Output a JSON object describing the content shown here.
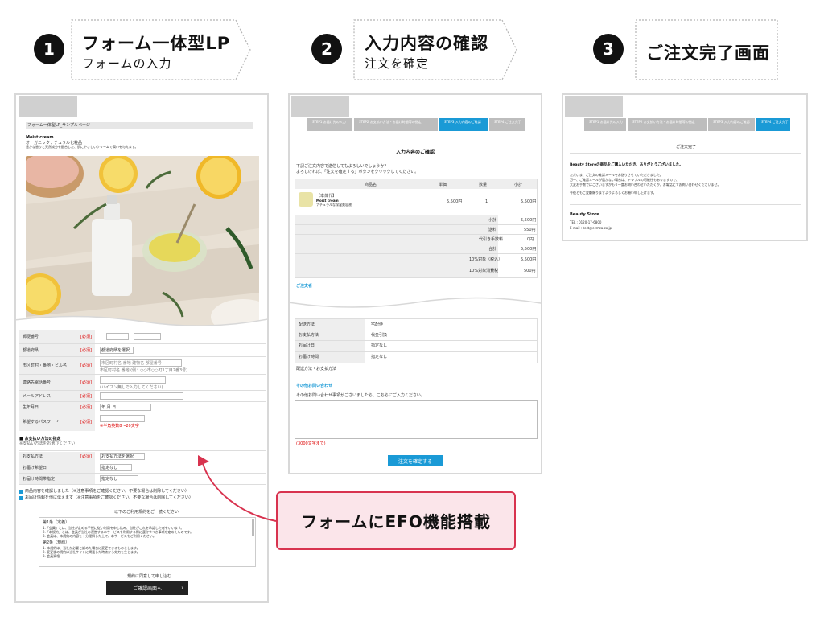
{
  "steps": [
    {
      "num": "1",
      "title": "フォーム一体型LP",
      "subtitle": "フォームの入力"
    },
    {
      "num": "2",
      "title": "入力内容の確認",
      "subtitle": "注文を確定"
    },
    {
      "num": "3",
      "title": "ご注文完了画面",
      "subtitle": ""
    }
  ],
  "callout": {
    "label": "フォームにEFO機能搭載"
  },
  "panel1": {
    "breadcrumb": "フォーム一体型LP_サンプルページ",
    "product_name": "Moist cream",
    "product_desc1": "オーガニックナチュラル化粧品",
    "product_desc2": "豊かな香りと天然成分を配合した、肌にやさしいクリームで潤いを与えます。",
    "fields": [
      {
        "label": "郵便番号",
        "req": "[必須]",
        "value": ""
      },
      {
        "label": "都道府県",
        "req": "[必須]",
        "value": "都道府県を選択"
      },
      {
        "label": "市区町村・番地・ビル名",
        "req": "[必須]",
        "value": "市区町村名 番地 建物名 部屋番号"
      },
      {
        "label": "連絡先電話番号",
        "req": "[必須]",
        "value": ""
      },
      {
        "label": "メールアドレス",
        "req": "[必須]",
        "value": ""
      },
      {
        "label": "生年月日",
        "req": "[必須]",
        "value": "年  月  日"
      },
      {
        "label": "希望するパスワード",
        "req": "[必須]",
        "value": ""
      }
    ],
    "address_note": "市区町村名 番地 (例：○○市○○町1丁目2番3号)",
    "phone_note": "(ハイフン無しで入力してください)",
    "password_note": "※半角英数8〜20文字",
    "payment_heading": "お支払い方法の指定",
    "payment_note": "※支払い方法をお選びください",
    "payment_rows": [
      {
        "label": "お支払方法",
        "req": "[必須]",
        "value": "お支払方法を選択"
      },
      {
        "label": "お届け希望日",
        "req": "",
        "value": "指定なし"
      },
      {
        "label": "お届け時間帯指定",
        "req": "",
        "value": "指定なし"
      }
    ],
    "check1": "商品内容を確認しました（※注意事項をご確認ください。不要な場合は削除してください）",
    "check2": "お届け情報を他に伝えます（※注意事項をご確認ください。不要な場合は削除してください）",
    "terms_heading": "以下のご利用規約をご一読ください",
    "terms_lines": [
      "第1条（定義）",
      "1.「会員」とは、当社が定める手続に従い利用を申し込み、当社がこれを承認した者をいいます。",
      "2.「本規約」とは、会員が当社の運営する本サービスを利用する際に遵守すべき事項を定めたものです。",
      "3. 会員は、本規約の内容を十分理解した上で、本サービスをご利用ください。",
      "第2条（規約）",
      "1. 本規約は、当社が必要と認めた場合に変更できるものとします。",
      "2. 変更後の規約は当社サイトに掲載した時点から効力を生じます。",
      "3. 会員資格"
    ],
    "agree_text": "規約に同意して申し込む",
    "confirm_button": "ご確認画面へ"
  },
  "panel2": {
    "progress": [
      "STEP1 お届け先の入力",
      "STEP2 お支払い方法・お届け時間等の指定",
      "STEP3 入力内容のご確認",
      "STEP4 ご注文完了"
    ],
    "heading": "入力内容のご確認",
    "intro1": "下記ご注文内容で送信してもよろしいでしょうか？",
    "intro2": "よろしければ、「注文を確定する」ボタンをクリックしてください。",
    "table_headers": [
      "商品名",
      "単価",
      "数量",
      "小計"
    ],
    "item_badge": "【本体代】",
    "item_name": "Moist cream",
    "item_desc": "ナチュラルな保湿美容液",
    "item_price": "5,500円",
    "item_qty": "1",
    "item_subtotal": "5,500円",
    "summary": [
      {
        "label": "小計",
        "value": "5,500円"
      },
      {
        "label": "送料",
        "value": "550円"
      },
      {
        "label": "代引き手数料",
        "value": "0円"
      },
      {
        "label": "合計",
        "value": "5,500円"
      }
    ],
    "tax_rows": [
      {
        "label": "10%対象（税込）",
        "value": "5,500円"
      },
      {
        "label": "10%対象消費税",
        "value": "500円"
      }
    ],
    "orderer_heading": "ご注文者",
    "shipping_rows": [
      {
        "label": "配送方法",
        "value": "宅配便"
      },
      {
        "label": "お支払方法",
        "value": "代金引換"
      },
      {
        "label": "お届け日",
        "value": "指定なし"
      },
      {
        "label": "お届け時間",
        "value": "指定なし"
      }
    ],
    "shipping_note": "配送方法・お支払方法",
    "inquiry_heading": "その他お問い合わせ",
    "inquiry_note": "その他お問い合わせ事項がございましたら、こちらにご入力ください。",
    "char_note": "(3000文字まで)",
    "confirm_button": "注文を確定する"
  },
  "panel3": {
    "progress": [
      "STEP1 お届け先の入力",
      "STEP2 お支払い方法・お届け時間等の指定",
      "STEP3 入力内容のご確認",
      "STEP4 ご注文完了"
    ],
    "heading": "ご注文完了",
    "thanks": "Beauty Storeの商品をご購入いただき、ありがとうございました。",
    "body1": "ただいま、ご注文の確認メールをお送りさせていただきました。",
    "body2": "万一、ご確認メールが届かない場合は、トラブルの可能性もありますので、",
    "body3": "大変お手数ではございますがもう一度お問い合わせいただくか、お電話にてお問い合わせくださいませ。",
    "body4": "今後ともご愛顧賜りますようよろしくお願い申し上げます。",
    "shop_name": "Beauty Store",
    "shop_tel": "TEL : 0120-17-6800",
    "shop_mail": "E-mail : test@ecmca.co.jp"
  }
}
